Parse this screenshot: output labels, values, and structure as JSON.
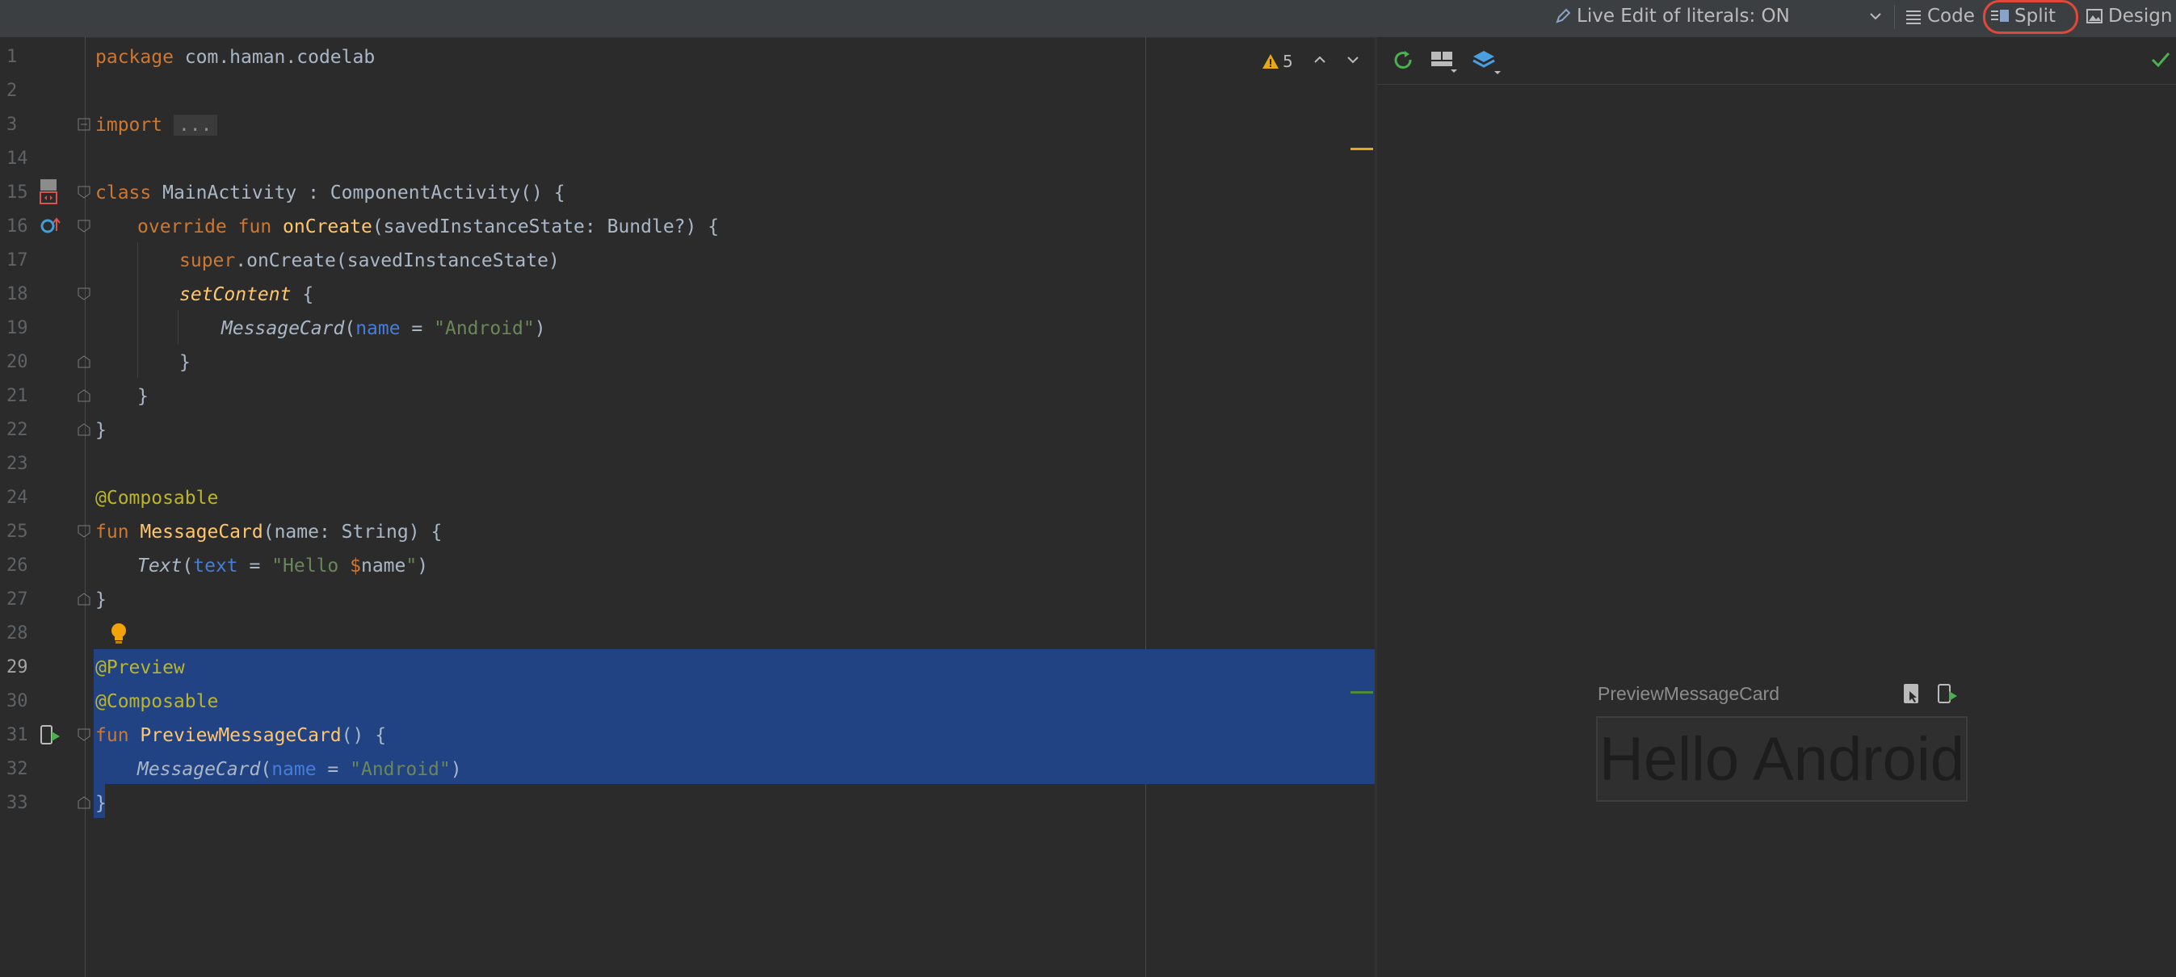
{
  "toolbar": {
    "live_edit_label": "Live Edit of literals: ON",
    "code_label": "Code",
    "split_label": "Split",
    "design_label": "Design"
  },
  "editor": {
    "warning_count": "5",
    "lines": [
      {
        "num": "1"
      },
      {
        "num": "2"
      },
      {
        "num": "3"
      },
      {
        "num": "14"
      },
      {
        "num": "15"
      },
      {
        "num": "16"
      },
      {
        "num": "17"
      },
      {
        "num": "18"
      },
      {
        "num": "19"
      },
      {
        "num": "20"
      },
      {
        "num": "21"
      },
      {
        "num": "22"
      },
      {
        "num": "23"
      },
      {
        "num": "24"
      },
      {
        "num": "25"
      },
      {
        "num": "26"
      },
      {
        "num": "27"
      },
      {
        "num": "28"
      },
      {
        "num": "29"
      },
      {
        "num": "30"
      },
      {
        "num": "31"
      },
      {
        "num": "32"
      },
      {
        "num": "33"
      }
    ],
    "code": {
      "l1_kw": "package",
      "l1_rest": " com.haman.codelab",
      "l3_kw": "import",
      "l3_dots": "...",
      "l15_kw": "class",
      "l15_rest": " MainActivity : ComponentActivity() {",
      "l16_kw": "override fun",
      "l16_fn": "onCreate",
      "l16_rest": "(savedInstanceState: Bundle?) {",
      "l17_kw": "super",
      "l17_rest": ".onCreate(savedInstanceState)",
      "l18_fn": "setContent",
      "l18_rest": " {",
      "l19_fn": "MessageCard",
      "l19_p1": "(",
      "l19_pn": "name",
      "l19_eq": " = ",
      "l19_st": "\"Android\"",
      "l19_p2": ")",
      "l20": "}",
      "l21": "}",
      "l22": "}",
      "l24_an": "@Composable",
      "l25_kw": "fun",
      "l25_fn": "MessageCard",
      "l25_rest": "(name: String) {",
      "l26_fn": "Text",
      "l26_p1": "(",
      "l26_pn": "text",
      "l26_eq": " = ",
      "l26_st1": "\"Hello ",
      "l26_dollar": "$",
      "l26_var": "name",
      "l26_st2": "\"",
      "l26_p2": ")",
      "l27": "}",
      "l29_an": "@Preview",
      "l30_an": "@Composable",
      "l31_kw": "fun",
      "l31_fn": "PreviewMessageCard",
      "l31_rest": "() {",
      "l32_fn": "MessageCard",
      "l32_p1": "(",
      "l32_pn": "name",
      "l32_eq": " = ",
      "l32_st": "\"Android\"",
      "l32_p2": ")",
      "l33": "}"
    }
  },
  "preview": {
    "component_name": "PreviewMessageCard",
    "rendered_text": "Hello Android"
  },
  "colors": {
    "selection": "#214283",
    "keyword": "#cc7832",
    "function": "#ffc66d",
    "annotation": "#bbb529",
    "string": "#6a8759",
    "param": "#467cda",
    "split_highlight": "#e2483a"
  }
}
